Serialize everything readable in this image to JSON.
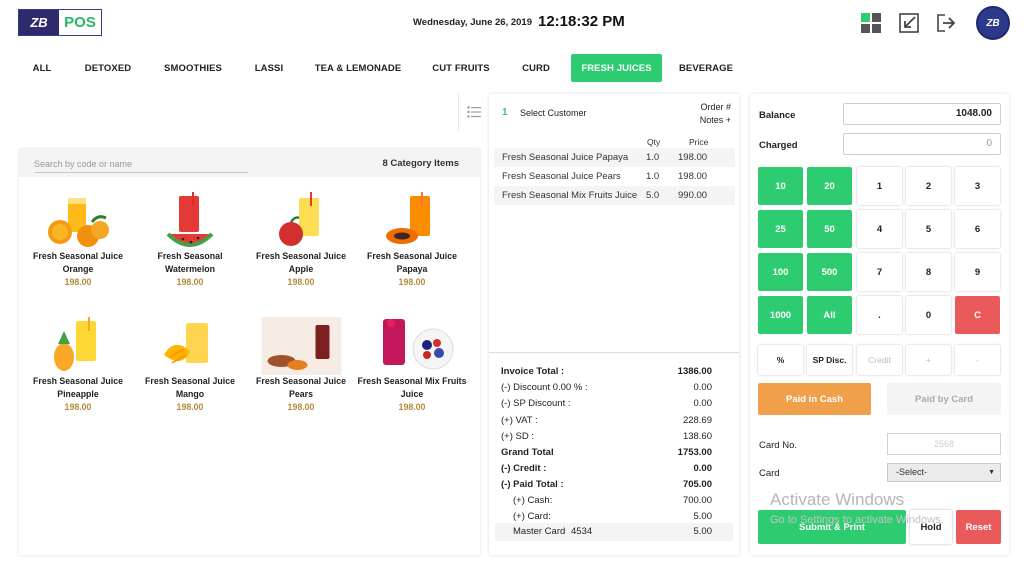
{
  "header": {
    "logo_mark": "ZB",
    "logo_text": "POS",
    "date": "Wednesday, June 26, 2019",
    "time": "12:18:32 PM",
    "avatar_text": "ZB",
    "icons": [
      "grid-icon",
      "minimize-icon",
      "logout-icon"
    ],
    "accent_color": "#2ecc71"
  },
  "tabs": [
    {
      "label": "ALL",
      "active": false
    },
    {
      "label": "DETOXED",
      "active": false
    },
    {
      "label": "SMOOTHIES",
      "active": false
    },
    {
      "label": "LASSI",
      "active": false
    },
    {
      "label": "TEA & LEMONADE",
      "active": false
    },
    {
      "label": "CUT FRUITS",
      "active": false
    },
    {
      "label": "CURD",
      "active": false
    },
    {
      "label": "FRESH JUICES",
      "active": true
    },
    {
      "label": "BEVERAGE",
      "active": false
    }
  ],
  "items_panel": {
    "search_placeholder": "Search by code or name",
    "category_count": "8 Category Items",
    "items": [
      {
        "name": "Fresh Seasonal Juice Orange",
        "price": "198.00"
      },
      {
        "name": "Fresh Seasonal Watermelon",
        "price": "198.00"
      },
      {
        "name": "Fresh Seasonal  Juice Apple",
        "price": "198.00"
      },
      {
        "name": "Fresh Seasonal Juice Papaya",
        "price": "198.00"
      },
      {
        "name": "Fresh Seasonal Juice Pineapple",
        "price": "198.00"
      },
      {
        "name": "Fresh Seasonal Juice Mango",
        "price": "198.00"
      },
      {
        "name": "Fresh Seasonal Juice Pears",
        "price": "198.00"
      },
      {
        "name": "Fresh Seasonal Mix Fruits Juice",
        "price": "198.00"
      }
    ]
  },
  "order": {
    "customer_number": "1",
    "customer_label": "Select Customer",
    "order_hash": "Order #",
    "notes": "Notes +",
    "col_qty": "Qty",
    "col_price": "Price",
    "lines": [
      {
        "name": "Fresh Seasonal Juice Papaya",
        "qty": "1.0",
        "price": "198.00"
      },
      {
        "name": "Fresh Seasonal Juice Pears",
        "qty": "1.0",
        "price": "198.00"
      },
      {
        "name": "Fresh Seasonal Mix Fruits Juice",
        "qty": "5.0",
        "price": "990.00"
      }
    ],
    "totals": [
      {
        "label": "Invoice Total :",
        "value": "1386.00",
        "bold": true,
        "indent": false
      },
      {
        "label": "(-) Discount  0.00 % :",
        "value": "0.00",
        "bold": false,
        "indent": false
      },
      {
        "label": "(-) SP Discount :",
        "value": "0.00",
        "bold": false,
        "indent": false
      },
      {
        "label": "(+) VAT :",
        "value": "228.69",
        "bold": false,
        "indent": false
      },
      {
        "label": "(+) SD :",
        "value": "138.60",
        "bold": false,
        "indent": false
      },
      {
        "label": "Grand Total",
        "value": "1753.00",
        "bold": true,
        "indent": false
      },
      {
        "label": "(-) Credit :",
        "value": "0.00",
        "bold": true,
        "indent": false
      },
      {
        "label": "(-) Paid Total :",
        "value": "705.00",
        "bold": true,
        "indent": false
      },
      {
        "label": "(+) Cash:",
        "value": "700.00",
        "bold": false,
        "indent": true
      },
      {
        "label": "(+) Card:",
        "value": "5.00",
        "bold": false,
        "indent": true
      }
    ],
    "master_card": {
      "label": "Master Card",
      "number": "4534",
      "value": "5.00"
    }
  },
  "payment": {
    "balance_label": "Balance",
    "balance_value": "1048.00",
    "charged_label": "Charged",
    "charged_value": "0",
    "quick_keys": [
      "10",
      "20",
      "25",
      "50",
      "100",
      "500",
      "1000",
      "All"
    ],
    "num_keys": [
      "1",
      "2",
      "3",
      "4",
      "5",
      "6",
      "7",
      "8",
      "9",
      ".",
      "0",
      "C"
    ],
    "action_keys": [
      "%",
      "SP Disc.",
      "Credit",
      "+",
      "-"
    ],
    "paid_cash": "Paid in Cash",
    "paid_card": "Paid by Card",
    "card_no_label": "Card No.",
    "card_no_value": "2568",
    "card_label": "Card",
    "card_select": "-Select-",
    "submit": "Submit & Print",
    "hold": "Hold",
    "reset": "Reset",
    "watermark_title": "Activate Windows",
    "watermark_sub": "Go to Settings to activate Windows."
  }
}
